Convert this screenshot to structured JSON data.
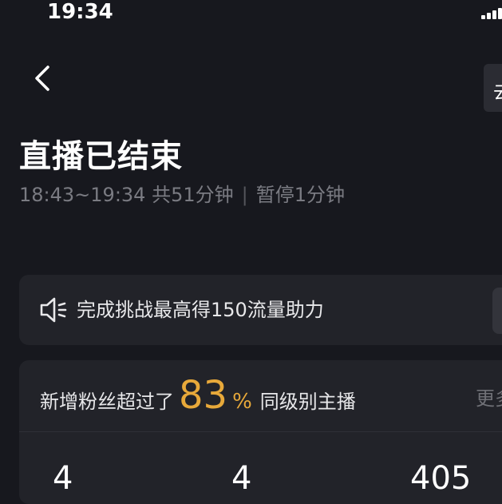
{
  "status_bar": {
    "time": "19:34"
  },
  "header": {
    "back_icon": "chevron-left-icon",
    "right_button_label": "去"
  },
  "summary": {
    "title": "直播已结束",
    "time_range": "18:43~19:34 共51分钟",
    "separator": "|",
    "pause": "暂停1分钟"
  },
  "challenge": {
    "icon": "speaker-icon",
    "text": "完成挑战最高得150流量助力"
  },
  "fans": {
    "prefix": "新增粉丝超过了",
    "percent": "83",
    "percent_sign": "%",
    "suffix": "同级别主播",
    "more_label": "更多",
    "stats": [
      "4",
      "4",
      "405"
    ]
  },
  "colors": {
    "background": "#17181e",
    "card": "#222329",
    "accent": "#e8a93a",
    "muted": "#7a7b82"
  }
}
